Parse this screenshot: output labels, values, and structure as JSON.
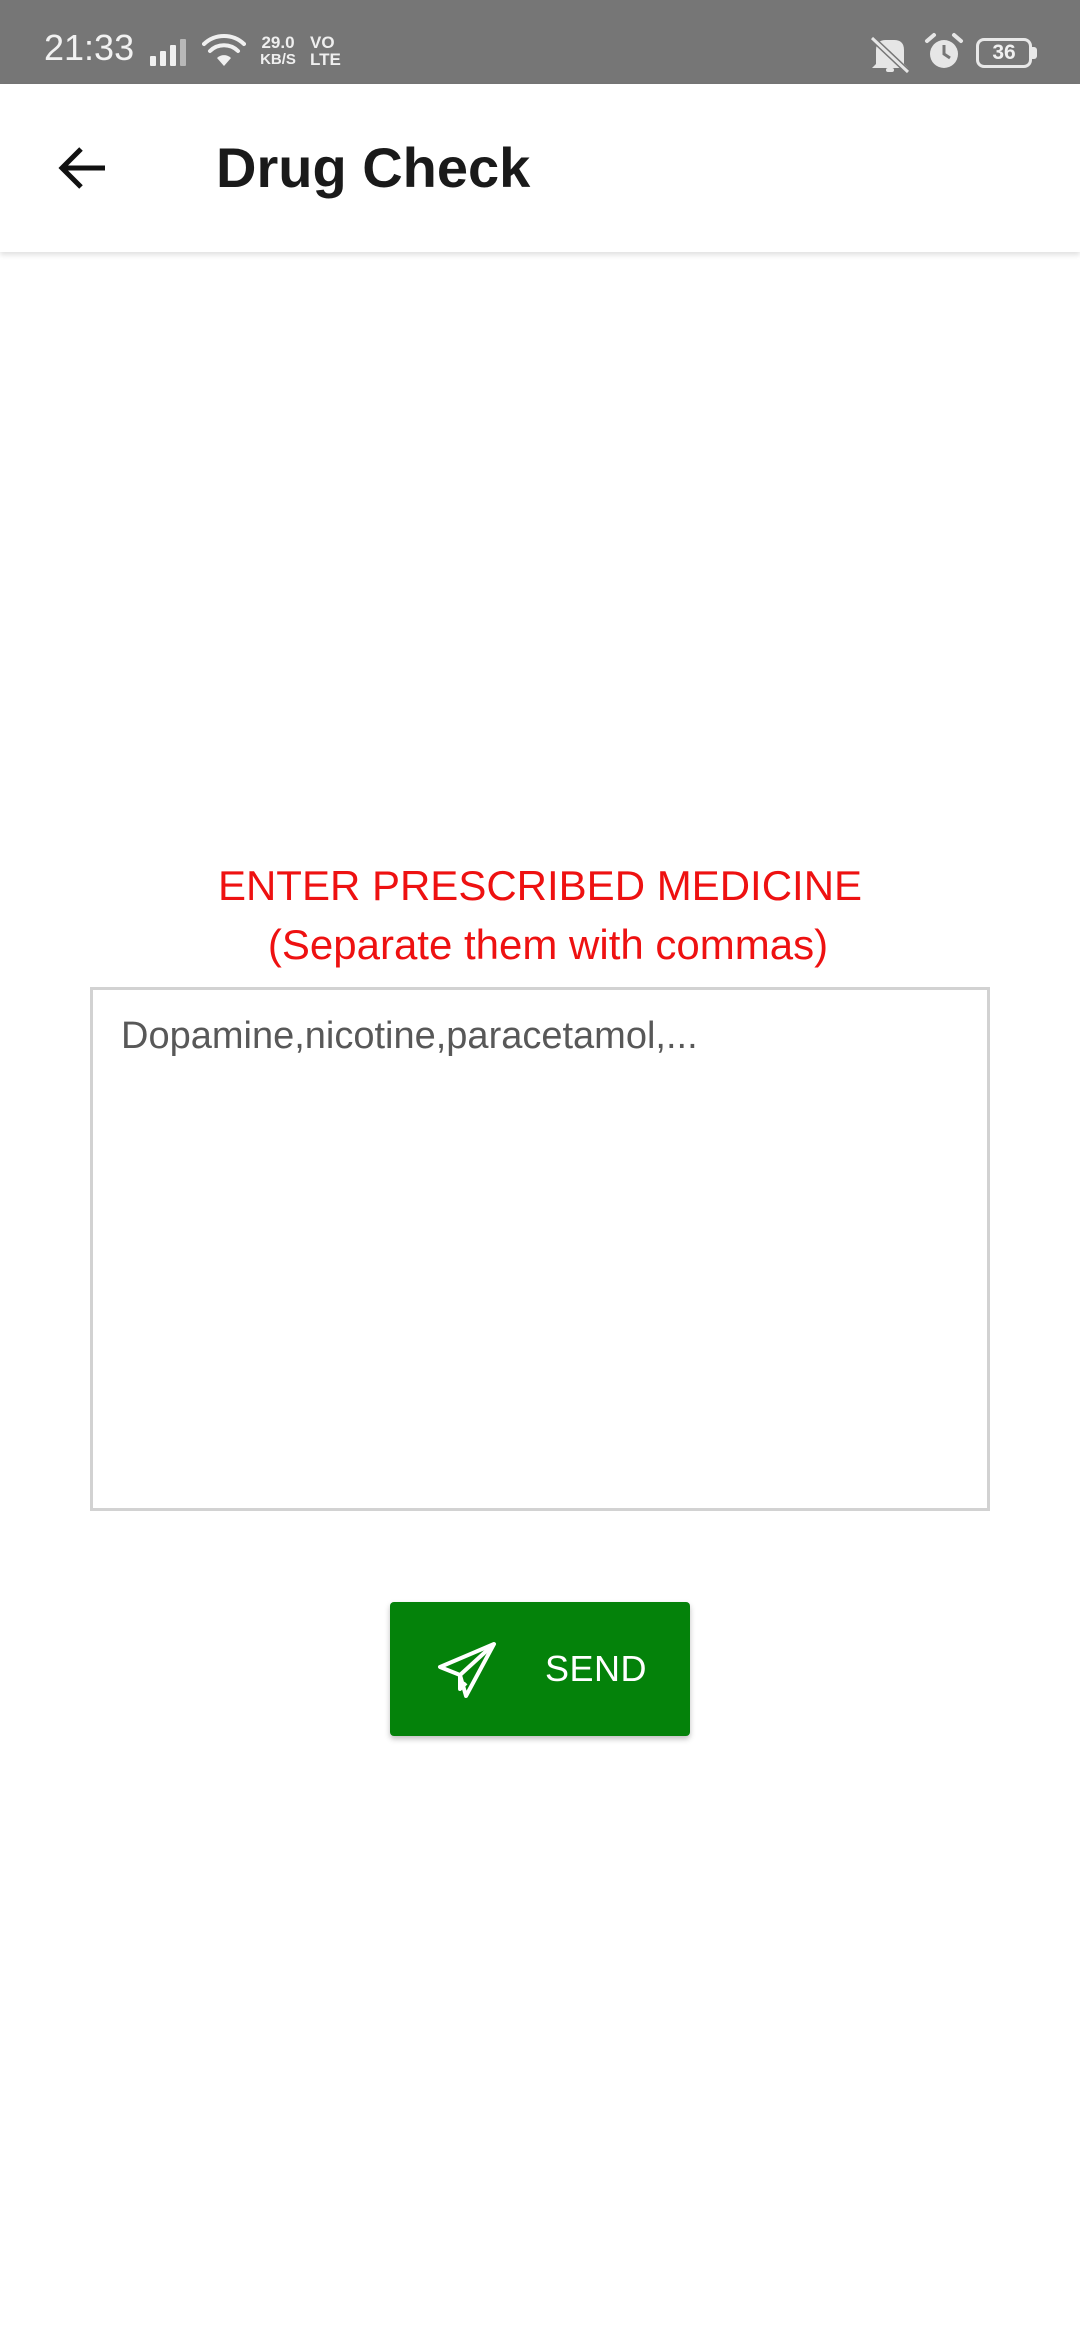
{
  "status_bar": {
    "time": "21:33",
    "net_speed_value": "29.0",
    "net_speed_unit": "KB/S",
    "volte_top": "VO",
    "volte_bottom": "LTE",
    "battery_level": "36",
    "icons": [
      "signal-icon",
      "wifi-icon",
      "mute-icon",
      "alarm-icon",
      "battery-icon"
    ]
  },
  "app_bar": {
    "title": "Drug Check",
    "back_icon": "arrow-back-icon"
  },
  "form": {
    "prompt_line1": "ENTER PRESCRIBED MEDICINE",
    "prompt_line2": "(Separate them with commas)",
    "prompt_color": "#ee1111",
    "input_placeholder": "Dopamine,nicotine,paracetamol,...",
    "input_value": ""
  },
  "send_button": {
    "label": "SEND",
    "icon": "send-paper-plane-icon",
    "color": "#04820a"
  }
}
